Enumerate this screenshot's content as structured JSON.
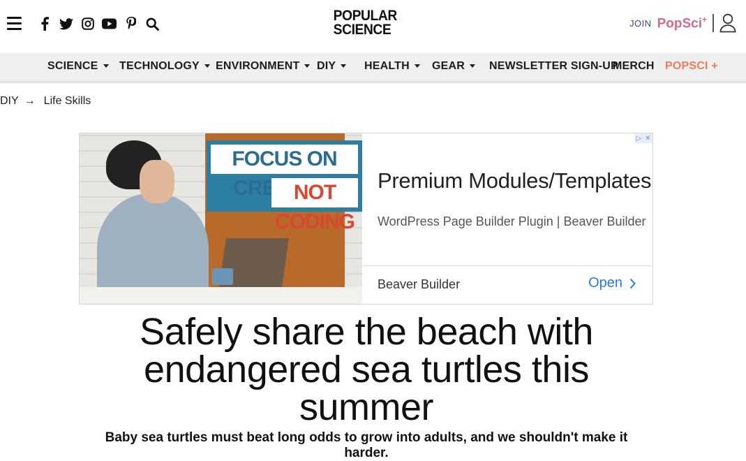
{
  "header": {
    "logo_line1": "POPULAR",
    "logo_line2": "SCIENCE",
    "join_label": "JOIN",
    "popsci_plus_label": "PopSci",
    "popsci_plus_symbol": "+",
    "icons": [
      "menu-icon",
      "facebook-icon",
      "twitter-icon",
      "instagram-icon",
      "youtube-icon",
      "pinterest-icon",
      "search-icon",
      "user-icon"
    ]
  },
  "nav": {
    "items": [
      {
        "label": "SCIENCE",
        "has_dropdown": true
      },
      {
        "label": "TECHNOLOGY",
        "has_dropdown": true
      },
      {
        "label": "ENVIRONMENT",
        "has_dropdown": true
      },
      {
        "label": "DIY",
        "has_dropdown": true
      },
      {
        "label": "HEALTH",
        "has_dropdown": true
      },
      {
        "label": "GEAR",
        "has_dropdown": true
      },
      {
        "label": "NEWSLETTER SIGN-UP",
        "has_dropdown": false
      },
      {
        "label": "MERCH",
        "has_dropdown": false
      },
      {
        "label": "POPSCI +",
        "has_dropdown": false
      }
    ],
    "accent_color": "#e6805a"
  },
  "breadcrumb": {
    "parent": "DIY",
    "arrow": "→",
    "current": "Life Skills"
  },
  "ad": {
    "banner_line1": "FOCUS ON CREATING",
    "banner_line2": "NOT CODING",
    "headline": "Premium Modules/Templates",
    "description": "WordPress Page Builder Plugin | Beaver Builder",
    "advertiser": "Beaver Builder",
    "cta": "Open",
    "cta_color": "#2a7ad9"
  },
  "article": {
    "title": "Safely share the beach with endangered sea turtles this summer",
    "subtitle": "Baby sea turtles must beat long odds to grow into adults, and we shouldn't make it harder."
  }
}
